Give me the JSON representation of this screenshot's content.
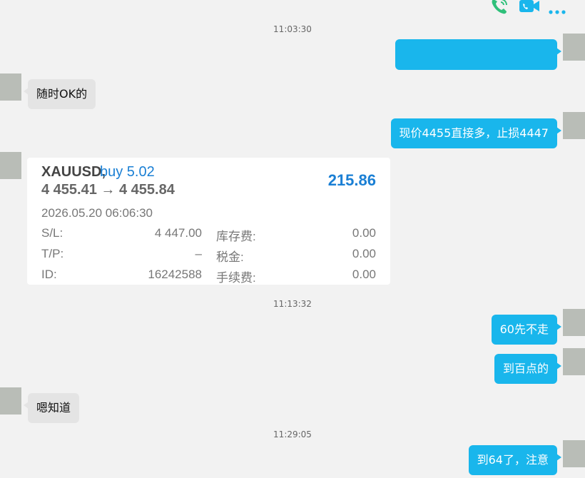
{
  "toolbar": {
    "icons": [
      "phone-call-icon",
      "video-call-icon",
      "more-icon"
    ]
  },
  "messages": {
    "ts1": "11:03:30",
    "m1": "",
    "m2": "随时OK的",
    "m3": "现价4455直接多，止损4447",
    "ts2": "11:13:32",
    "m4": "60先不走",
    "m5": "到百点的",
    "m6": "嗯知道",
    "ts3": "11:29:05",
    "m7": "到64了，注意"
  },
  "trade_card": {
    "symbol": "XAUUSD,",
    "side": "buy 5.02",
    "prices": "4 455.41 → 4 455.84",
    "profit": "215.86",
    "datetime": "2026.05.20 06:06:30",
    "sl_label": "S/L:",
    "sl_value": "4 447.00",
    "tp_label": "T/P:",
    "tp_value": "–",
    "id_label": "ID:",
    "id_value": "16242588",
    "swap_label": "库存费:",
    "swap_value": "0.00",
    "tax_label": "税金:",
    "tax_value": "0.00",
    "fee_label": "手续费:",
    "fee_value": "0.00"
  },
  "colors": {
    "outgoing_bubble": "#19b6ec",
    "incoming_bubble": "#e4e4e4",
    "trade_accent": "#1a7fd4",
    "icon_green": "#2fc07a",
    "icon_blue": "#19b6ec"
  }
}
